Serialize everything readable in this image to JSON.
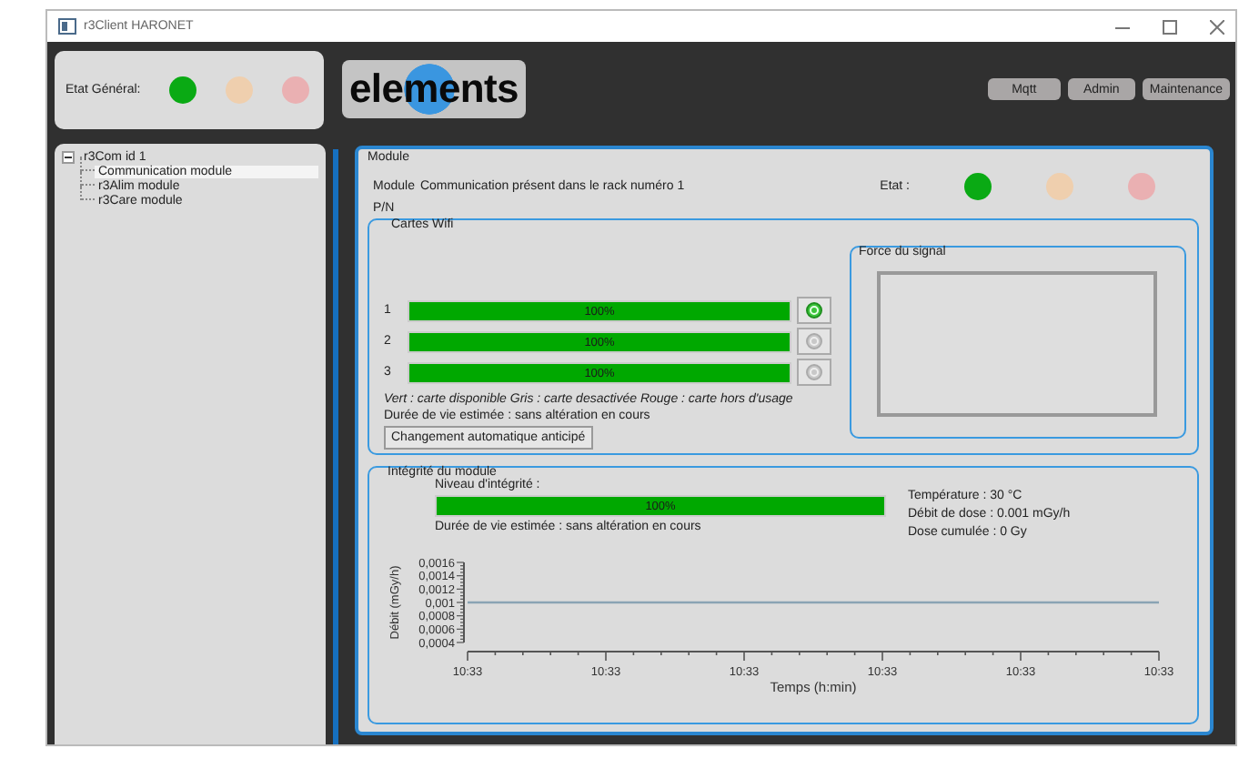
{
  "window": {
    "title": "r3Client HARONET"
  },
  "general_status": {
    "label": "Etat Général:",
    "lights": [
      {
        "color": "#0aaa14"
      },
      {
        "color": "#efcfae"
      },
      {
        "color": "#eab0b2"
      }
    ]
  },
  "logo": "elements",
  "buttons": [
    "Mqtt",
    "Admin",
    "Maintenance"
  ],
  "tree": [
    {
      "label": "r3Com id 1",
      "expanded": true,
      "selected": false,
      "children": [
        {
          "label": "Communication module",
          "selected": true
        },
        {
          "label": "r3Alim module",
          "selected": false
        },
        {
          "label": "r3Care module",
          "selected": false
        }
      ]
    }
  ],
  "module": {
    "title": "Module",
    "description_label": "Module",
    "description": "Communication présent dans le rack numéro  1",
    "state_label": "Etat :",
    "lights": [
      {
        "color": "#0aaa14"
      },
      {
        "color": "#efcfae"
      },
      {
        "color": "#eab0b2"
      }
    ],
    "pn_label": "P/N",
    "wifi": {
      "title": "Cartes Wifi",
      "cards": [
        {
          "number": "1",
          "level": 1,
          "reading": "100%",
          "active": true
        },
        {
          "number": "2",
          "level": 1,
          "reading": "100%",
          "active": false
        },
        {
          "number": "3",
          "level": 1,
          "reading": "100%",
          "active": false
        }
      ],
      "legend": "Vert : carte disponible  Gris : carte desactivée  Rouge : carte hors d'usage",
      "lifetime": "Durée de vie estimée : sans altération en cours",
      "button": "Changement automatique anticipé",
      "signal": {
        "title": "Force du signal"
      }
    },
    "integrity": {
      "title": "Intégrité du module",
      "level_label": "Niveau d'intégrité :",
      "level": 1,
      "reading": "100%",
      "lifetime": "Durée de vie estimée : sans altération en cours",
      "stats": [
        "Température : 30 °C",
        "Débit de dose : 0.001 mGy/h",
        "Dose cumulée  : 0 Gy"
      ],
      "chart_data": {
        "type": "line",
        "xlabel": "Temps (h:min)",
        "ylabel": "Débit (mGy/h)",
        "categories": [
          "10:33",
          "10:33",
          "10:33",
          "10:33",
          "10:33",
          "10:33"
        ],
        "series": [
          {
            "color": "#8aa4b4",
            "values": [
              0.001,
              0.001,
              0.001,
              0.001,
              0.001,
              0.001
            ]
          }
        ],
        "ylim": [
          0.0004,
          0.0016
        ],
        "yticks": [
          {
            "value": 0.0004,
            "label": "0,0004"
          },
          {
            "value": 0.0006,
            "label": "0,0006"
          },
          {
            "value": 0.0008,
            "label": "0,0008"
          },
          {
            "value": 0.001,
            "label": "0,001"
          },
          {
            "value": 0.0012,
            "label": "0,0012"
          },
          {
            "value": 0.0014,
            "label": "0,0014"
          },
          {
            "value": 0.0016,
            "label": "0,0016"
          }
        ]
      }
    }
  }
}
